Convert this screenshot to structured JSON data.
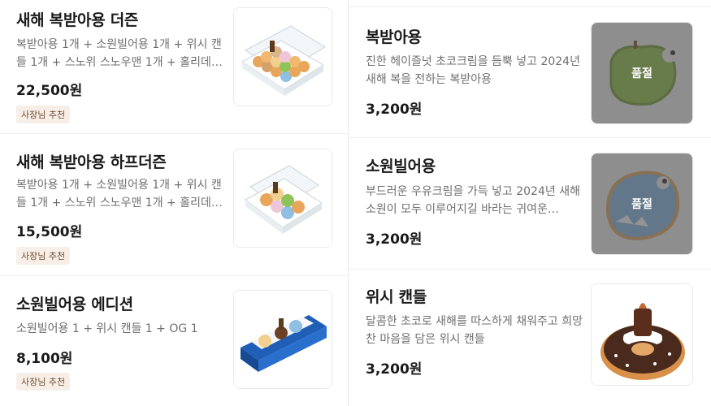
{
  "left_items": [
    {
      "name": "새해 복받아용 더즌",
      "desc": "복받아용 1개 + 소원빌어용 1개 + 위시 캔들 1개 + 스노위 스노우맨 1개 + 홀리데이 기…",
      "price": "22,500원",
      "badge": "사장님 추천",
      "image": "dozen-box-icon"
    },
    {
      "name": "새해 복받아용 하프더즌",
      "desc": "복받아용 1개 + 소원빌어용 1개 + 위시 캔들 1개 + 스노위 스노우맨 1개 + 홀리데이 기…",
      "price": "15,500원",
      "badge": "사장님 추천",
      "image": "half-dozen-box-icon"
    },
    {
      "name": "소원빌어용 에디션",
      "desc": "소원빌어용 1 + 위시 캔들 1 + OG 1",
      "price": "8,100원",
      "badge": "사장님 추천",
      "image": "edition-box-icon"
    }
  ],
  "right_items": [
    {
      "name": "복받아용",
      "desc": "진한 헤이즐넛 초코크림을 듬뿍 넣고 2024년 새해 복을 전하는 복받아용",
      "price": "3,200원",
      "soldout": "품절",
      "image": "green-dragon-donut-icon"
    },
    {
      "name": "소원빌어용",
      "desc": "부드러운 우유크림을 가득 넣고 2024년 새해 소원이 모두 이루어지길 바라는 귀여운…",
      "price": "3,200원",
      "soldout": "품절",
      "image": "blue-dragon-donut-icon"
    },
    {
      "name": "위시 캔들",
      "desc": "달콤한 초코로 새해를 따스하게 채워주고 희망찬 마음을 담은 위시 캔들",
      "price": "3,200원",
      "image": "candle-donut-icon"
    }
  ],
  "colors": {
    "text": "#1a1a1a",
    "muted": "#6f6f6f",
    "badge_bg": "#f7efe7",
    "badge_text": "#6b4b2e",
    "soldout_overlay": "#505050"
  }
}
